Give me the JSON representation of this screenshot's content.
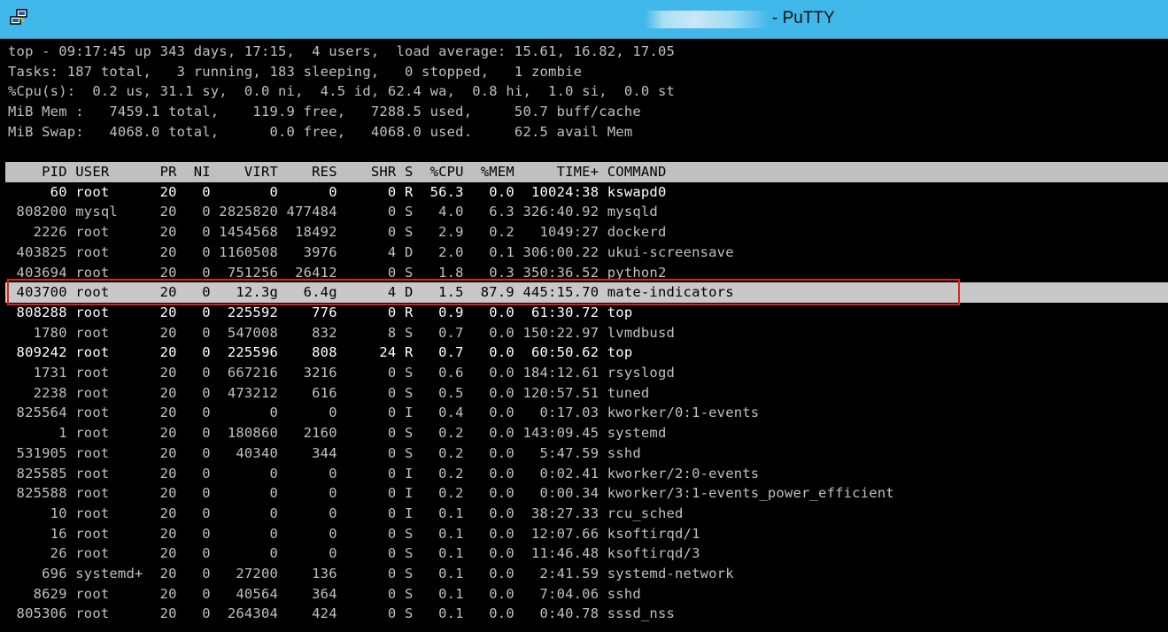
{
  "window": {
    "title": "- PuTTY"
  },
  "summary": [
    "top - 09:17:45 up 343 days, 17:15,  4 users,  load average: 15.61, 16.82, 17.05",
    "Tasks: 187 total,   3 running, 183 sleeping,   0 stopped,   1 zombie",
    "%Cpu(s):  0.2 us, 31.1 sy,  0.0 ni,  4.5 id, 62.4 wa,  0.8 hi,  1.0 si,  0.0 st",
    "MiB Mem :   7459.1 total,    119.9 free,   7288.5 used,     50.7 buff/cache",
    "MiB Swap:   4068.0 total,      0.0 free,   4068.0 used.     62.5 avail Mem"
  ],
  "header": "    PID USER      PR  NI    VIRT    RES    SHR S  %CPU  %MEM     TIME+ COMMAND",
  "processes": [
    "     60 root      20   0       0      0      0 R  56.3   0.0  10024:38 kswapd0",
    " 808200 mysql     20   0 2825820 477484      0 S   4.0   6.3 326:40.92 mysqld",
    "   2226 root      20   0 1454568  18492      0 S   2.9   0.2   1049:27 dockerd",
    " 403825 root      20   0 1160508   3976      4 D   2.0   0.1 306:00.22 ukui-screensave",
    " 403694 root      20   0  751256  26412      0 S   1.8   0.3 350:36.52 python2",
    " 403700 root      20   0   12.3g   6.4g      4 D   1.5  87.9 445:15.70 mate-indicators",
    " 808288 root      20   0  225592    776      0 R   0.9   0.0  61:30.72 top",
    "   1780 root      20   0  547008    832      8 S   0.7   0.0 150:22.97 lvmdbusd",
    " 809242 root      20   0  225596    808     24 R   0.7   0.0  60:50.62 top",
    "   1731 root      20   0  667216   3216      0 S   0.6   0.0 184:12.61 rsyslogd",
    "   2238 root      20   0  473212    616      0 S   0.5   0.0 120:57.51 tuned",
    " 825564 root      20   0       0      0      0 I   0.4   0.0   0:17.03 kworker/0:1-events",
    "      1 root      20   0  180860   2160      0 S   0.2   0.0 143:09.45 systemd",
    " 531905 root      20   0   40340    344      0 S   0.2   0.0   5:47.59 sshd",
    " 825585 root      20   0       0      0      0 I   0.2   0.0   0:02.41 kworker/2:0-events",
    " 825588 root      20   0       0      0      0 I   0.2   0.0   0:00.34 kworker/3:1-events_power_efficient",
    "     10 root      20   0       0      0      0 I   0.1   0.0  38:27.33 rcu_sched",
    "     16 root      20   0       0      0      0 S   0.1   0.0  12:07.66 ksoftirqd/1",
    "     26 root      20   0       0      0      0 S   0.1   0.0  11:46.48 ksoftirqd/3",
    "    696 systemd+  20   0   27200    136      0 S   0.1   0.0   2:41.59 systemd-network",
    "   8629 root      20   0   40564    364      0 S   0.1   0.0   7:04.06 sshd",
    " 805306 root      20   0  264304    424      0 S   0.1   0.0   0:40.78 sssd_nss"
  ],
  "colors": {
    "titlebar": "#41b8ea",
    "highlight_box": "#e02020",
    "terminal_bg": "#000000",
    "terminal_fg": "#c0c0c0"
  }
}
